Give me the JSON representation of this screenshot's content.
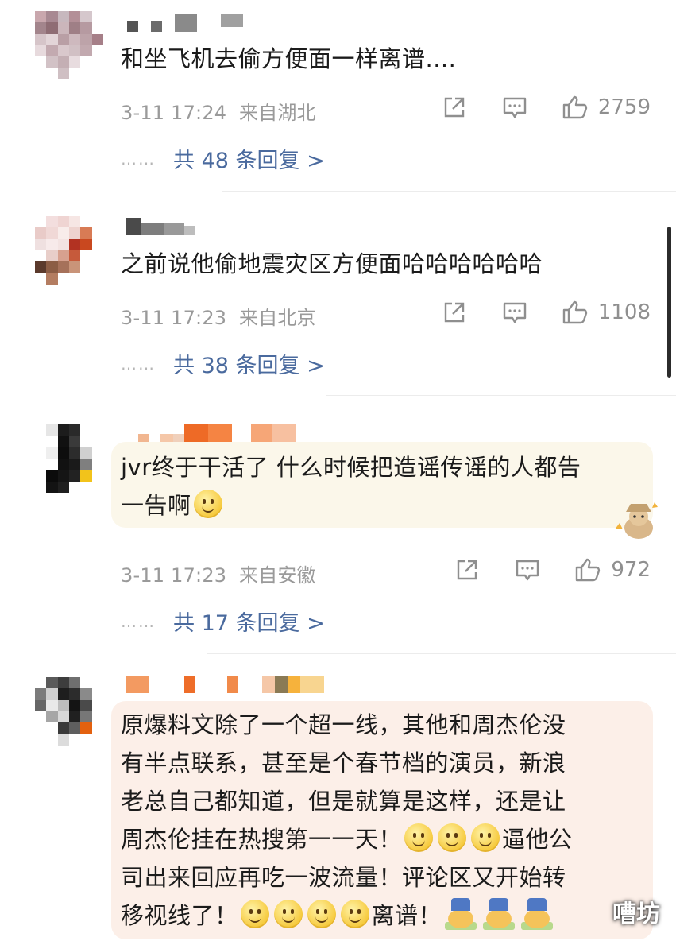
{
  "comments": [
    {
      "text_lines": [
        "和坐飞机去偷方便面一样离谱...."
      ],
      "time": "3-11 17:24",
      "location": "来自湖北",
      "likes": "2759",
      "replies": "共 48 条回复 >"
    },
    {
      "text_lines": [
        "之前说他偷地震灾区方便面哈哈哈哈哈哈"
      ],
      "time": "3-11 17:23",
      "location": "来自北京",
      "likes": "1108",
      "replies": "共 38 条回复 >"
    },
    {
      "text_lines": [
        "jvr终于干活了 什么时候把造谣传谣的人都告",
        "一告啊"
      ],
      "time": "3-11 17:23",
      "location": "来自安徽",
      "likes": "972",
      "replies": "共 17 条回复 >"
    },
    {
      "text_lines": [
        "原爆料文除了一个超一线，其他和周杰伦没",
        "有半点联系，甚至是个春节档的演员，新浪",
        "老总自己都知道，但是就算是这样，还是让",
        "周杰伦挂在热搜第一一天！",
        "逼他公",
        "司出来回应再吃一波流量！评论区又开始转",
        "移视线了！",
        "离谱！"
      ]
    }
  ],
  "replies_dots": "……",
  "icons": {
    "share": "share-icon",
    "comment": "comment-icon",
    "like": "thumbs-up-icon",
    "emoji": "smile-emoji-icon"
  },
  "colors": {
    "link": "#4a6a9e",
    "meta": "#9a9a9a",
    "bubble_warm": "#fbf7ea",
    "bubble_pink": "#fcefe8"
  },
  "watermark": "嘈坊"
}
